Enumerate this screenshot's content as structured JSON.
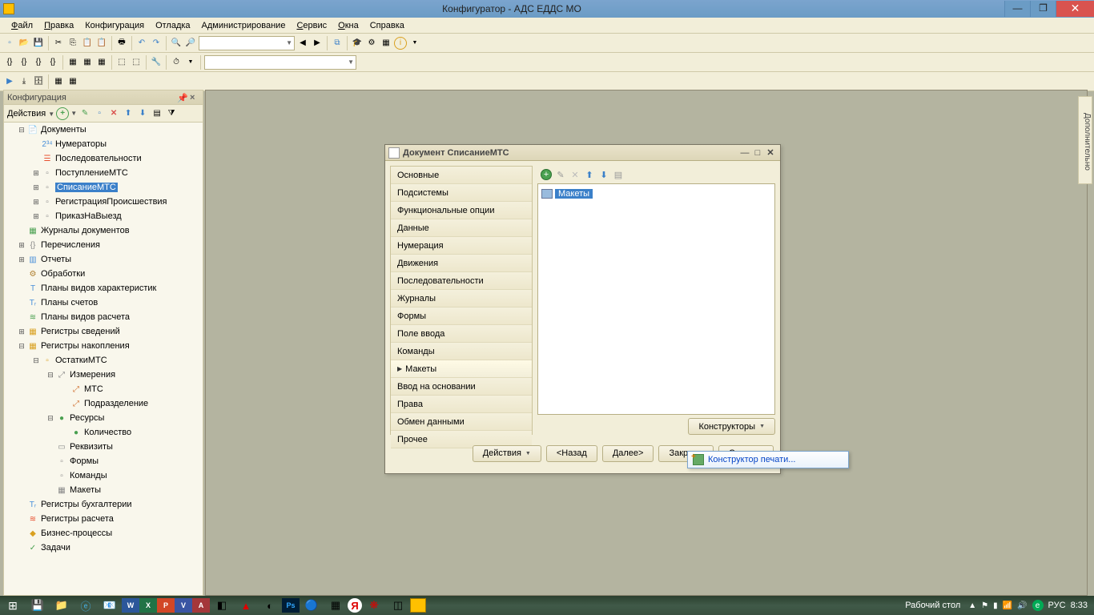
{
  "window": {
    "title": "Конфигуратор - АДС ЕДДС МО"
  },
  "menu": {
    "file": "Файл",
    "edit": "Правка",
    "config": "Конфигурация",
    "debug": "Отладка",
    "admin": "Администрирование",
    "service": "Сервис",
    "windows": "Окна",
    "help": "Справка"
  },
  "sidepanel": {
    "title": "Конфигурация",
    "actions": "Действия",
    "tree": [
      {
        "level": 1,
        "exp": "⊟",
        "icon": "📄",
        "label": "Документы",
        "col": "#e8a030"
      },
      {
        "level": 2,
        "exp": "",
        "icon": "2³⁴",
        "label": "Нумераторы",
        "col": "#4a90d9"
      },
      {
        "level": 2,
        "exp": "",
        "icon": "☰",
        "label": "Последовательности",
        "col": "#e85030"
      },
      {
        "level": 2,
        "exp": "⊞",
        "icon": "▫",
        "label": "ПоступлениеМТС",
        "col": "#888"
      },
      {
        "level": 2,
        "exp": "⊞",
        "icon": "▫",
        "label": "СписаниеМТС",
        "col": "#888",
        "sel": true
      },
      {
        "level": 2,
        "exp": "⊞",
        "icon": "▫",
        "label": "РегистрацияПроисшествия",
        "col": "#888"
      },
      {
        "level": 2,
        "exp": "⊞",
        "icon": "▫",
        "label": "ПриказНаВыезд",
        "col": "#888"
      },
      {
        "level": 1,
        "exp": "",
        "icon": "▦",
        "label": "Журналы документов",
        "col": "#4aa050"
      },
      {
        "level": 1,
        "exp": "⊞",
        "icon": "{}",
        "label": "Перечисления",
        "col": "#888"
      },
      {
        "level": 1,
        "exp": "⊞",
        "icon": "▥",
        "label": "Отчеты",
        "col": "#4a90d9"
      },
      {
        "level": 1,
        "exp": "",
        "icon": "⚙",
        "label": "Обработки",
        "col": "#b08030"
      },
      {
        "level": 1,
        "exp": "",
        "icon": "T",
        "label": "Планы видов характеристик",
        "col": "#4a90d9"
      },
      {
        "level": 1,
        "exp": "",
        "icon": "Тᵣ",
        "label": "Планы счетов",
        "col": "#4a90d9"
      },
      {
        "level": 1,
        "exp": "",
        "icon": "≋",
        "label": "Планы видов расчета",
        "col": "#4aa050"
      },
      {
        "level": 1,
        "exp": "⊞",
        "icon": "▦",
        "label": "Регистры сведений",
        "col": "#d9a020"
      },
      {
        "level": 1,
        "exp": "⊟",
        "icon": "▦",
        "label": "Регистры накопления",
        "col": "#d9a020"
      },
      {
        "level": 2,
        "exp": "⊟",
        "icon": "▫",
        "label": "ОстаткиМТС",
        "col": "#d9a020"
      },
      {
        "level": 3,
        "exp": "⊟",
        "icon": "⤢",
        "label": "Измерения",
        "col": "#888"
      },
      {
        "level": 4,
        "exp": "",
        "icon": "⤢",
        "label": "МТС",
        "col": "#d07030"
      },
      {
        "level": 4,
        "exp": "",
        "icon": "⤢",
        "label": "Подразделение",
        "col": "#d07030"
      },
      {
        "level": 3,
        "exp": "⊟",
        "icon": "●",
        "label": "Ресурсы",
        "col": "#4aa050"
      },
      {
        "level": 4,
        "exp": "",
        "icon": "●",
        "label": "Количество",
        "col": "#4aa050"
      },
      {
        "level": 3,
        "exp": "",
        "icon": "▭",
        "label": "Реквизиты",
        "col": "#888"
      },
      {
        "level": 3,
        "exp": "",
        "icon": "▫",
        "label": "Формы",
        "col": "#888"
      },
      {
        "level": 3,
        "exp": "",
        "icon": "▫",
        "label": "Команды",
        "col": "#888"
      },
      {
        "level": 3,
        "exp": "",
        "icon": "▦",
        "label": "Макеты",
        "col": "#888"
      },
      {
        "level": 1,
        "exp": "",
        "icon": "Тᵣ",
        "label": "Регистры бухгалтерии",
        "col": "#4a90d9"
      },
      {
        "level": 1,
        "exp": "",
        "icon": "≋",
        "label": "Регистры расчета",
        "col": "#e85030"
      },
      {
        "level": 1,
        "exp": "",
        "icon": "◆",
        "label": "Бизнес-процессы",
        "col": "#d9a020"
      },
      {
        "level": 1,
        "exp": "",
        "icon": "✓",
        "label": "Задачи",
        "col": "#4aa050"
      }
    ]
  },
  "doc": {
    "title": "Документ СписаниеМТС",
    "tabs": [
      "Основные",
      "Подсистемы",
      "Функциональные опции",
      "Данные",
      "Нумерация",
      "Движения",
      "Последовательности",
      "Журналы",
      "Формы",
      "Поле ввода",
      "Команды",
      "Макеты",
      "Ввод на основании",
      "Права",
      "Обмен данными",
      "Прочее"
    ],
    "activeTab": 11,
    "treeRoot": "Макеты",
    "constructors": "Конструкторы",
    "actions": "Действия",
    "back": "<Назад",
    "next": "Далее>",
    "close": "Закрыть",
    "help": "Справка"
  },
  "popup": {
    "item": "Конструктор печати..."
  },
  "dockRight": "Дополнительно",
  "taskbar": {
    "desk": "Рабочий стол",
    "lang": "РУС",
    "time": "8:33"
  }
}
